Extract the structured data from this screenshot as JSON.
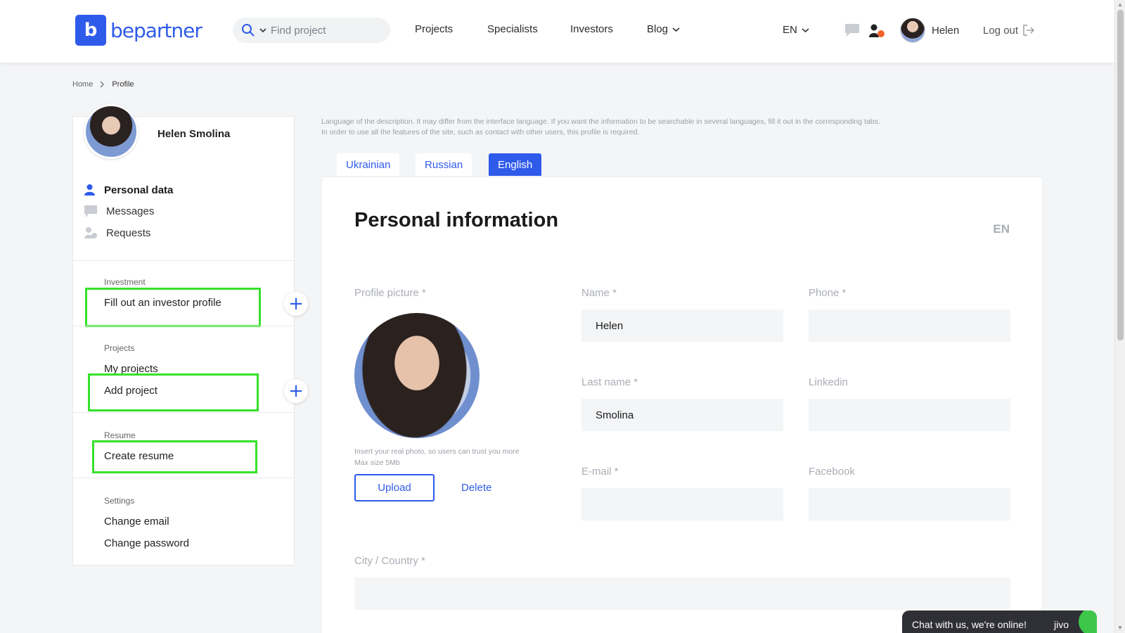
{
  "header": {
    "logo_mark": "b",
    "logo_text": "bepartner",
    "search": {
      "placeholder": "Find project"
    },
    "nav": [
      "Projects",
      "Specialists",
      "Investors",
      "Blog"
    ],
    "language": "EN",
    "user_name": "Helen",
    "logout_label": "Log out"
  },
  "breadcrumb": {
    "home": "Home",
    "current": "Profile"
  },
  "sidebar": {
    "user_full_name": "Helen Smolina",
    "main_items": [
      "Personal data",
      "Messages",
      "Requests"
    ],
    "investment": {
      "title": "Investment",
      "link": "Fill out an investor profile"
    },
    "projects": {
      "title": "Projects",
      "my_projects": "My projects",
      "add_project": "Add project"
    },
    "resume": {
      "title": "Resume",
      "create": "Create resume"
    },
    "settings": {
      "title": "Settings",
      "change_email": "Change email",
      "change_password": "Change password"
    }
  },
  "main": {
    "note_line1": "Language of the description. It may differ from the interface language. If you want the information to be searchable in several languages, fill it out in the corresponding tabs.",
    "note_line2": "In order to use all the features of the site, such as contact with other users, this profile is required.",
    "tabs": [
      "Ukrainian",
      "Russian",
      "English"
    ],
    "active_tab": "English",
    "title": "Personal information",
    "lang_badge": "EN",
    "profile_picture_label": "Profile picture *",
    "photo_hint_1": "Insert your real photo, so users can trust you more",
    "photo_hint_2": "Max size 5Mb",
    "upload_label": "Upload",
    "delete_label": "Delete",
    "fields": {
      "name": {
        "label": "Name *",
        "value": "Helen"
      },
      "phone": {
        "label": "Phone *",
        "value": ""
      },
      "last_name": {
        "label": "Last name *",
        "value": "Smolina"
      },
      "linkedin": {
        "label": "Linkedin",
        "value": ""
      },
      "email": {
        "label": "E-mail *",
        "value": ""
      },
      "facebook": {
        "label": "Facebook",
        "value": ""
      },
      "city_country": {
        "label": "City / Country *",
        "value": ""
      }
    }
  },
  "chat": {
    "text": "Chat with us, we're online!",
    "brand": "jivo"
  },
  "colors": {
    "accent": "#2f5bea",
    "highlight": "#35e12a",
    "background": "#f4f5f7"
  }
}
